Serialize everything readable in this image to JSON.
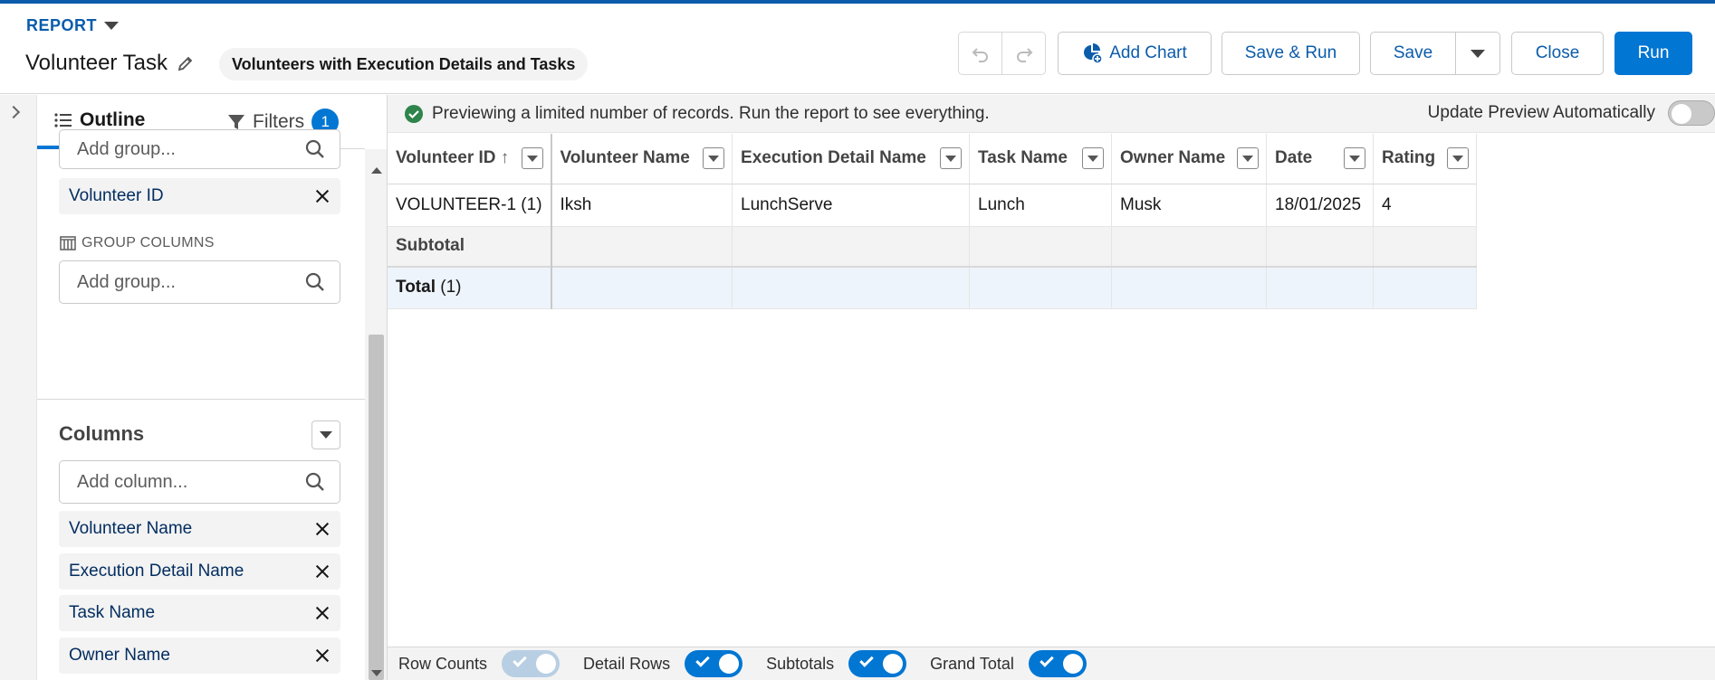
{
  "header": {
    "object_label": "REPORT",
    "report_name": "Volunteer Task",
    "report_type": "Volunteers with Execution Details and Tasks",
    "add_chart_label": "Add Chart",
    "save_run_label": "Save & Run",
    "save_label": "Save",
    "close_label": "Close",
    "run_label": "Run"
  },
  "sidebar": {
    "outline_tab": "Outline",
    "filters_tab": "Filters",
    "filters_count": "1",
    "group_rows_placeholder": "Add group...",
    "group_rows": [
      "Volunteer ID"
    ],
    "group_columns_label": "GROUP COLUMNS",
    "group_columns_placeholder": "Add group...",
    "columns_heading": "Columns",
    "columns_placeholder": "Add column...",
    "columns": [
      "Volunteer Name",
      "Execution Detail Name",
      "Task Name",
      "Owner Name"
    ]
  },
  "preview": {
    "message": "Previewing a limited number of records. Run the report to see everything.",
    "auto_update_label": "Update Preview Automatically",
    "auto_update_on": false
  },
  "table": {
    "headers": [
      "Volunteer ID",
      "Volunteer Name",
      "Execution Detail Name",
      "Task Name",
      "Owner Name",
      "Date",
      "Rating"
    ],
    "sort_arrow": "↑",
    "row": [
      "VOLUNTEER-1 (1)",
      "Iksh",
      "LunchServe",
      "Lunch",
      "Musk",
      "18/01/2025",
      "4"
    ],
    "subtotal_label": "Subtotal",
    "total_label": "Total",
    "total_count": "(1)"
  },
  "footer": {
    "row_counts_label": "Row Counts",
    "detail_rows_label": "Detail Rows",
    "subtotals_label": "Subtotals",
    "grand_total_label": "Grand Total"
  },
  "colors": {
    "brand": "#0176d3",
    "brand_dark": "#0b5cab",
    "success": "#2e844a"
  }
}
